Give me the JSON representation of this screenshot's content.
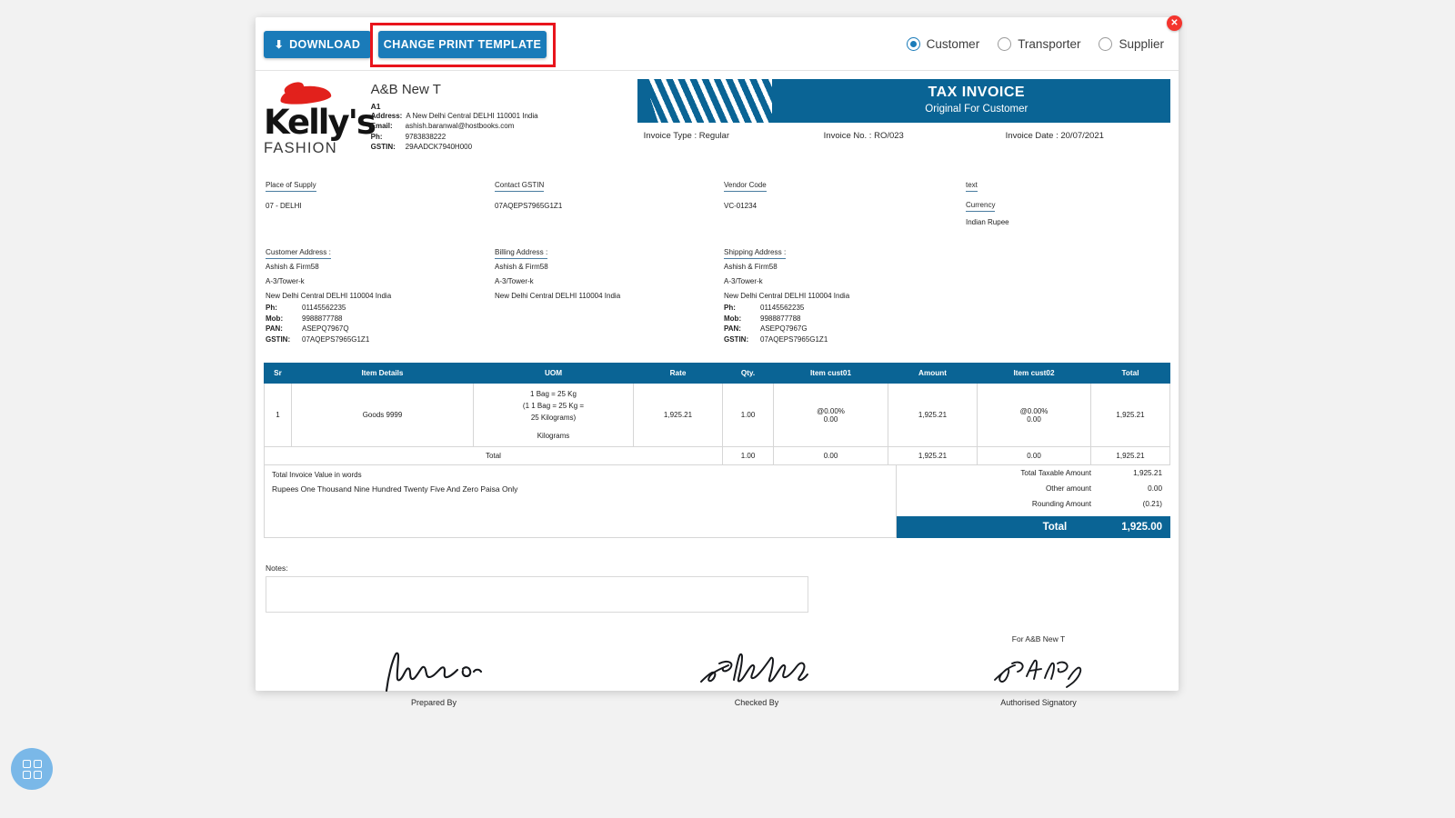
{
  "toolbar": {
    "download_label": "DOWNLOAD",
    "download_icon": "download-icon",
    "change_template_label": "CHANGE PRINT TEMPLATE",
    "close_label": "✕",
    "radios": [
      {
        "label": "Customer",
        "selected": true
      },
      {
        "label": "Transporter",
        "selected": false
      },
      {
        "label": "Supplier",
        "selected": false
      }
    ]
  },
  "colors": {
    "accent_blue": "#1a7bb9",
    "banner_blue": "#0a6495",
    "highlight_red": "#e8141c",
    "close_red": "#f4352e",
    "logo_red": "#e2211c",
    "fab_blue": "#7ab8e8"
  },
  "logo": {
    "brand": "Kelly's",
    "tagline": "FASHION"
  },
  "seller": {
    "name": "A&B New T",
    "branch": "A1",
    "address_label": "Address:",
    "address_value": "A New Delhi Central DELHI 110001 India",
    "email_label": "Email:",
    "email_value": "ashish.baranwal@hostbooks.com",
    "phone_label": "Ph:",
    "phone_value": "9783838222",
    "gstin_label": "GSTIN:",
    "gstin_value": "29AADCK7940H000"
  },
  "banner": {
    "title": "TAX INVOICE",
    "subtitle": "Original For Customer"
  },
  "invoice_meta": {
    "type": "Invoice Type : Regular",
    "number": "Invoice No. : RO/023",
    "date": "Invoice Date : 20/07/2021"
  },
  "meta_strip": {
    "place_of_supply_label": "Place of Supply",
    "place_of_supply_value": "07 - DELHI",
    "contact_gstin_label": "Contact GSTIN",
    "contact_gstin_value": "07AQEPS7965G1Z1",
    "vendor_code_label": "Vendor Code",
    "vendor_code_value": "VC-01234",
    "text_label": "text",
    "currency_label": "Currency",
    "currency_value": "Indian Rupee"
  },
  "addresses": {
    "customer": {
      "title": "Customer Address :",
      "line1": "Ashish & Firm58",
      "line2": "A-3/Tower-k",
      "line3": "New Delhi Central DELHI 110004 India",
      "ph_label": "Ph:",
      "ph_value": "01145562235",
      "mob_label": "Mob:",
      "mob_value": "9988877788",
      "pan_label": "PAN:",
      "pan_value": "ASEPQ7967Q",
      "gstin_label": "GSTIN:",
      "gstin_value": "07AQEPS7965G1Z1"
    },
    "billing": {
      "title": "Billing Address :",
      "line1": "Ashish & Firm58",
      "line2": "A-3/Tower-k",
      "line3": "New Delhi Central DELHI 110004 India"
    },
    "shipping": {
      "title": "Shipping Address :",
      "line1": "Ashish & Firm58",
      "line2": "A-3/Tower-k",
      "line3": "New Delhi Central DELHI 110004 India",
      "ph_label": "Ph:",
      "ph_value": "01145562235",
      "mob_label": "Mob:",
      "mob_value": "9988877788",
      "pan_label": "PAN:",
      "pan_value": "ASEPQ7967G",
      "gstin_label": "GSTIN:",
      "gstin_value": "07AQEPS7965G1Z1"
    }
  },
  "items_table": {
    "headers": [
      "Sr",
      "Item Details",
      "UOM",
      "Rate",
      "Qty.",
      "Item cust01",
      "Amount",
      "Item cust02",
      "Total"
    ],
    "rows": [
      {
        "sr": "1",
        "item": "Goods 9999",
        "uom_l1": "1 Bag = 25 Kg",
        "uom_l2": "(1 1 Bag = 25 Kg =",
        "uom_l3": "25 Kilograms)",
        "uom_l4": "Kilograms",
        "rate": "1,925.21",
        "qty": "1.00",
        "cust01_pct": "@0.00%",
        "cust01_amt": "0.00",
        "amount": "1,925.21",
        "cust02_pct": "@0.00%",
        "cust02_amt": "0.00",
        "total": "1,925.21"
      }
    ],
    "footer": {
      "label": "Total",
      "qty": "1.00",
      "cust01": "0.00",
      "amount": "1,925.21",
      "cust02": "0.00",
      "total": "1,925.21"
    }
  },
  "totals": {
    "words_label": "Total Invoice Value in words",
    "words_value": "Rupees One Thousand Nine Hundred Twenty Five And Zero Paisa Only",
    "rows": [
      {
        "label": "Total Taxable Amount",
        "value": "1,925.21"
      },
      {
        "label": "Other amount",
        "value": "0.00"
      },
      {
        "label": "Rounding Amount",
        "value": "(0.21)"
      }
    ],
    "grand_label": "Total",
    "grand_value": "1,925.00"
  },
  "notes": {
    "label": "Notes:",
    "value": ""
  },
  "signatures": {
    "prepared_by": "Prepared By",
    "checked_by": "Checked By",
    "authorised_signatory": "Authorised Signatory",
    "for_company": "For A&B New T"
  },
  "fab": {
    "name": "apps-grid-button"
  }
}
